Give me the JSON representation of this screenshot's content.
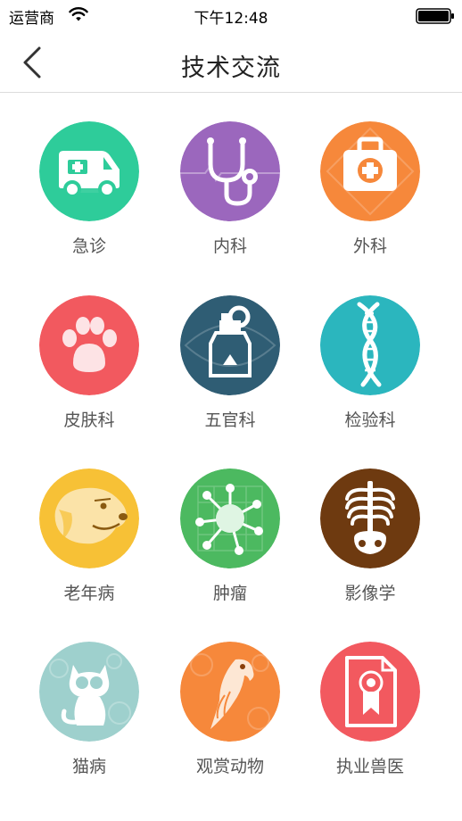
{
  "status_bar": {
    "carrier": "运营商",
    "time": "下午12:48"
  },
  "nav": {
    "title": "技术交流",
    "back_icon": "chevron-left-icon"
  },
  "categories": [
    {
      "label": "急诊",
      "icon": "ambulance-icon",
      "color": "#2ECC9A"
    },
    {
      "label": "内科",
      "icon": "stethoscope-icon",
      "color": "#9B67BD"
    },
    {
      "label": "外科",
      "icon": "first-aid-kit-icon",
      "color": "#F6883B"
    },
    {
      "label": "皮肤科",
      "icon": "paw-icon",
      "color": "#F2595F"
    },
    {
      "label": "五官科",
      "icon": "ear-drops-bottle-icon",
      "color": "#2F5D74"
    },
    {
      "label": "检验科",
      "icon": "dna-icon",
      "color": "#2BB6BE"
    },
    {
      "label": "老年病",
      "icon": "old-dog-icon",
      "color": "#F7C136"
    },
    {
      "label": "肿瘤",
      "icon": "tumor-cell-icon",
      "color": "#4CB960"
    },
    {
      "label": "影像学",
      "icon": "xray-skeleton-icon",
      "color": "#6E3A10"
    },
    {
      "label": "猫病",
      "icon": "cat-icon",
      "color": "#9ED0CD"
    },
    {
      "label": "观赏动物",
      "icon": "parrot-icon",
      "color": "#F6883B"
    },
    {
      "label": "执业兽医",
      "icon": "certificate-icon",
      "color": "#F2595F"
    }
  ]
}
